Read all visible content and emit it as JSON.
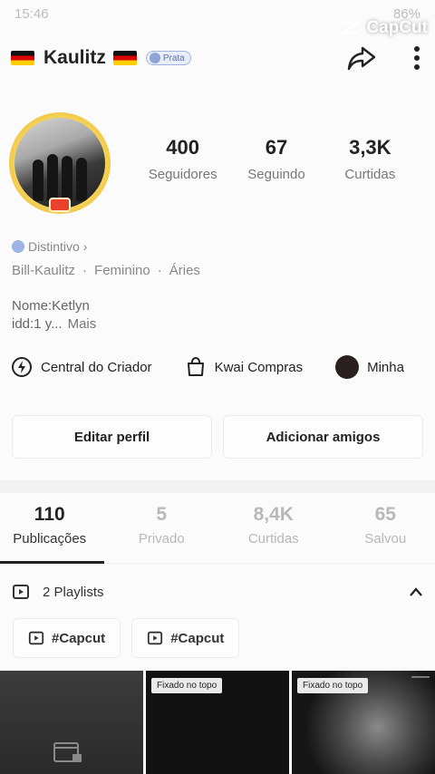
{
  "status_bar": {
    "time": "15:46",
    "battery": "86%"
  },
  "watermark": {
    "label": "CapCut"
  },
  "header": {
    "username": "Kaulitz",
    "badge": "Prata",
    "icons": [
      "share-icon",
      "more-vertical-icon"
    ]
  },
  "stats": [
    {
      "value": "400",
      "label": "Seguidores"
    },
    {
      "value": "67",
      "label": "Seguindo"
    },
    {
      "value": "3,3K",
      "label": "Curtidas"
    }
  ],
  "profile": {
    "distintivo": "Distintivo",
    "tags": [
      "Bill-Kaulitz",
      "·",
      "Feminino",
      "·",
      "Áries"
    ],
    "bio_line1": "Nome:Ketlyn",
    "bio_line2": "idd:1 y...",
    "bio_more": "Mais"
  },
  "quick_links": [
    {
      "label": "Central do Criador",
      "icon": "lightning-icon"
    },
    {
      "label": "Kwai Compras",
      "icon": "shopping-bag-icon"
    },
    {
      "label": "Minha",
      "icon": "avatar"
    }
  ],
  "actions": {
    "edit": "Editar perfil",
    "add_friends": "Adicionar amigos"
  },
  "tabs": [
    {
      "value": "110",
      "label": "Publicações"
    },
    {
      "value": "5",
      "label": "Privado"
    },
    {
      "value": "8,4K",
      "label": "Curtidas"
    },
    {
      "value": "65",
      "label": "Salvou"
    }
  ],
  "playlists": {
    "label": "2 Playlists",
    "chips": [
      "#Capcut",
      "#Capcut"
    ]
  },
  "grid": {
    "pinned_label": "Fixado no topo"
  },
  "colors": {
    "background": "#fbfbfb",
    "text": "#222222",
    "muted": "#888888",
    "avatar_ring": "#e3a718"
  }
}
